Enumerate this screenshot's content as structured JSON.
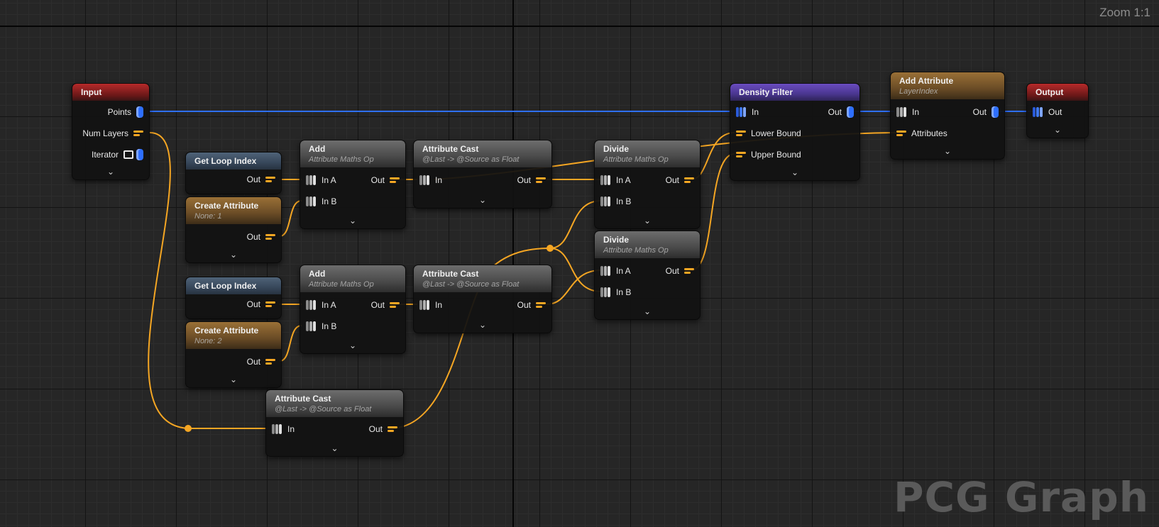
{
  "zoom_label": "Zoom 1:1",
  "watermark": "PCG Graph",
  "icons": {
    "chevron": "expand-chevron-icon",
    "point_pin": "blue-point-pin-icon",
    "attribute_pin": "orange-attribute-pin-icon",
    "stack_pin": "grey-stack-pin-icon",
    "loop": "loop-iterator-icon"
  },
  "colors": {
    "canvas": "#262626",
    "wire_point": "#2e6fff",
    "wire_attribute": "#f5a623",
    "header_input_output": "#b72a2a",
    "header_density_filter": "#6a4cbf",
    "header_create_attribute": "#9a7036",
    "header_get_loop_index": "#4f6378",
    "header_generic": "#6d6d6d"
  },
  "chevron_symbol": "⌄",
  "nodes": {
    "input": {
      "title": "Input",
      "pins": {
        "points": "Points",
        "num_layers": "Num Layers",
        "iterator": "Iterator"
      }
    },
    "get_loop_index_1": {
      "title": "Get Loop Index",
      "out": "Out"
    },
    "create_attribute_1": {
      "title": "Create Attribute",
      "subtitle": "None: 1",
      "out": "Out"
    },
    "add_1": {
      "title": "Add",
      "subtitle": "Attribute Maths Op",
      "in_a": "In A",
      "in_b": "In B",
      "out": "Out"
    },
    "attribute_cast_1": {
      "title": "Attribute Cast",
      "subtitle": "@Last -> @Source as Float",
      "in": "In",
      "out": "Out"
    },
    "divide_1": {
      "title": "Divide",
      "subtitle": "Attribute Maths Op",
      "in_a": "In A",
      "in_b": "In B",
      "out": "Out"
    },
    "get_loop_index_2": {
      "title": "Get Loop Index",
      "out": "Out"
    },
    "create_attribute_2": {
      "title": "Create Attribute",
      "subtitle": "None: 2",
      "out": "Out"
    },
    "add_2": {
      "title": "Add",
      "subtitle": "Attribute Maths Op",
      "in_a": "In A",
      "in_b": "In B",
      "out": "Out"
    },
    "attribute_cast_2": {
      "title": "Attribute Cast",
      "subtitle": "@Last -> @Source as Float",
      "in": "In",
      "out": "Out"
    },
    "divide_2": {
      "title": "Divide",
      "subtitle": "Attribute Maths Op",
      "in_a": "In A",
      "in_b": "In B",
      "out": "Out"
    },
    "attribute_cast_3": {
      "title": "Attribute Cast",
      "subtitle": "@Last -> @Source as Float",
      "in": "In",
      "out": "Out"
    },
    "density_filter": {
      "title": "Density Filter",
      "in": "In",
      "out": "Out",
      "lower_bound": "Lower Bound",
      "upper_bound": "Upper Bound"
    },
    "add_attribute": {
      "title": "Add Attribute",
      "subtitle": "LayerIndex",
      "in": "In",
      "out": "Out",
      "attributes": "Attributes"
    },
    "output": {
      "title": "Output",
      "out": "Out"
    }
  }
}
